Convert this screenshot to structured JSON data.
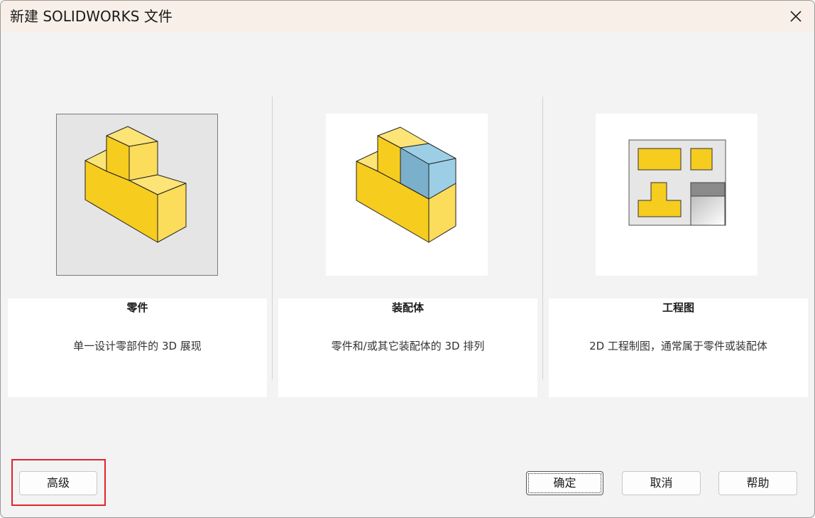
{
  "window": {
    "title": "新建 SOLIDWORKS 文件",
    "close_icon": "close-icon"
  },
  "templates": [
    {
      "name": "零件",
      "description": "单一设计零部件的 3D 展现",
      "icon": "part-icon",
      "selected": true
    },
    {
      "name": "装配体",
      "description": "零件和/或其它装配体的 3D 排列",
      "icon": "assembly-icon",
      "selected": false
    },
    {
      "name": "工程图",
      "description": "2D 工程制图，通常属于零件或装配体",
      "icon": "drawing-icon",
      "selected": false
    }
  ],
  "buttons": {
    "advanced": "高级",
    "ok": "确定",
    "cancel": "取消",
    "help": "帮助"
  },
  "colors": {
    "title_bar": "#f8f0e8",
    "highlight_box": "#e0242c",
    "part_yellow": "#f6cc1e",
    "assembly_blue": "#9ccfe6"
  }
}
